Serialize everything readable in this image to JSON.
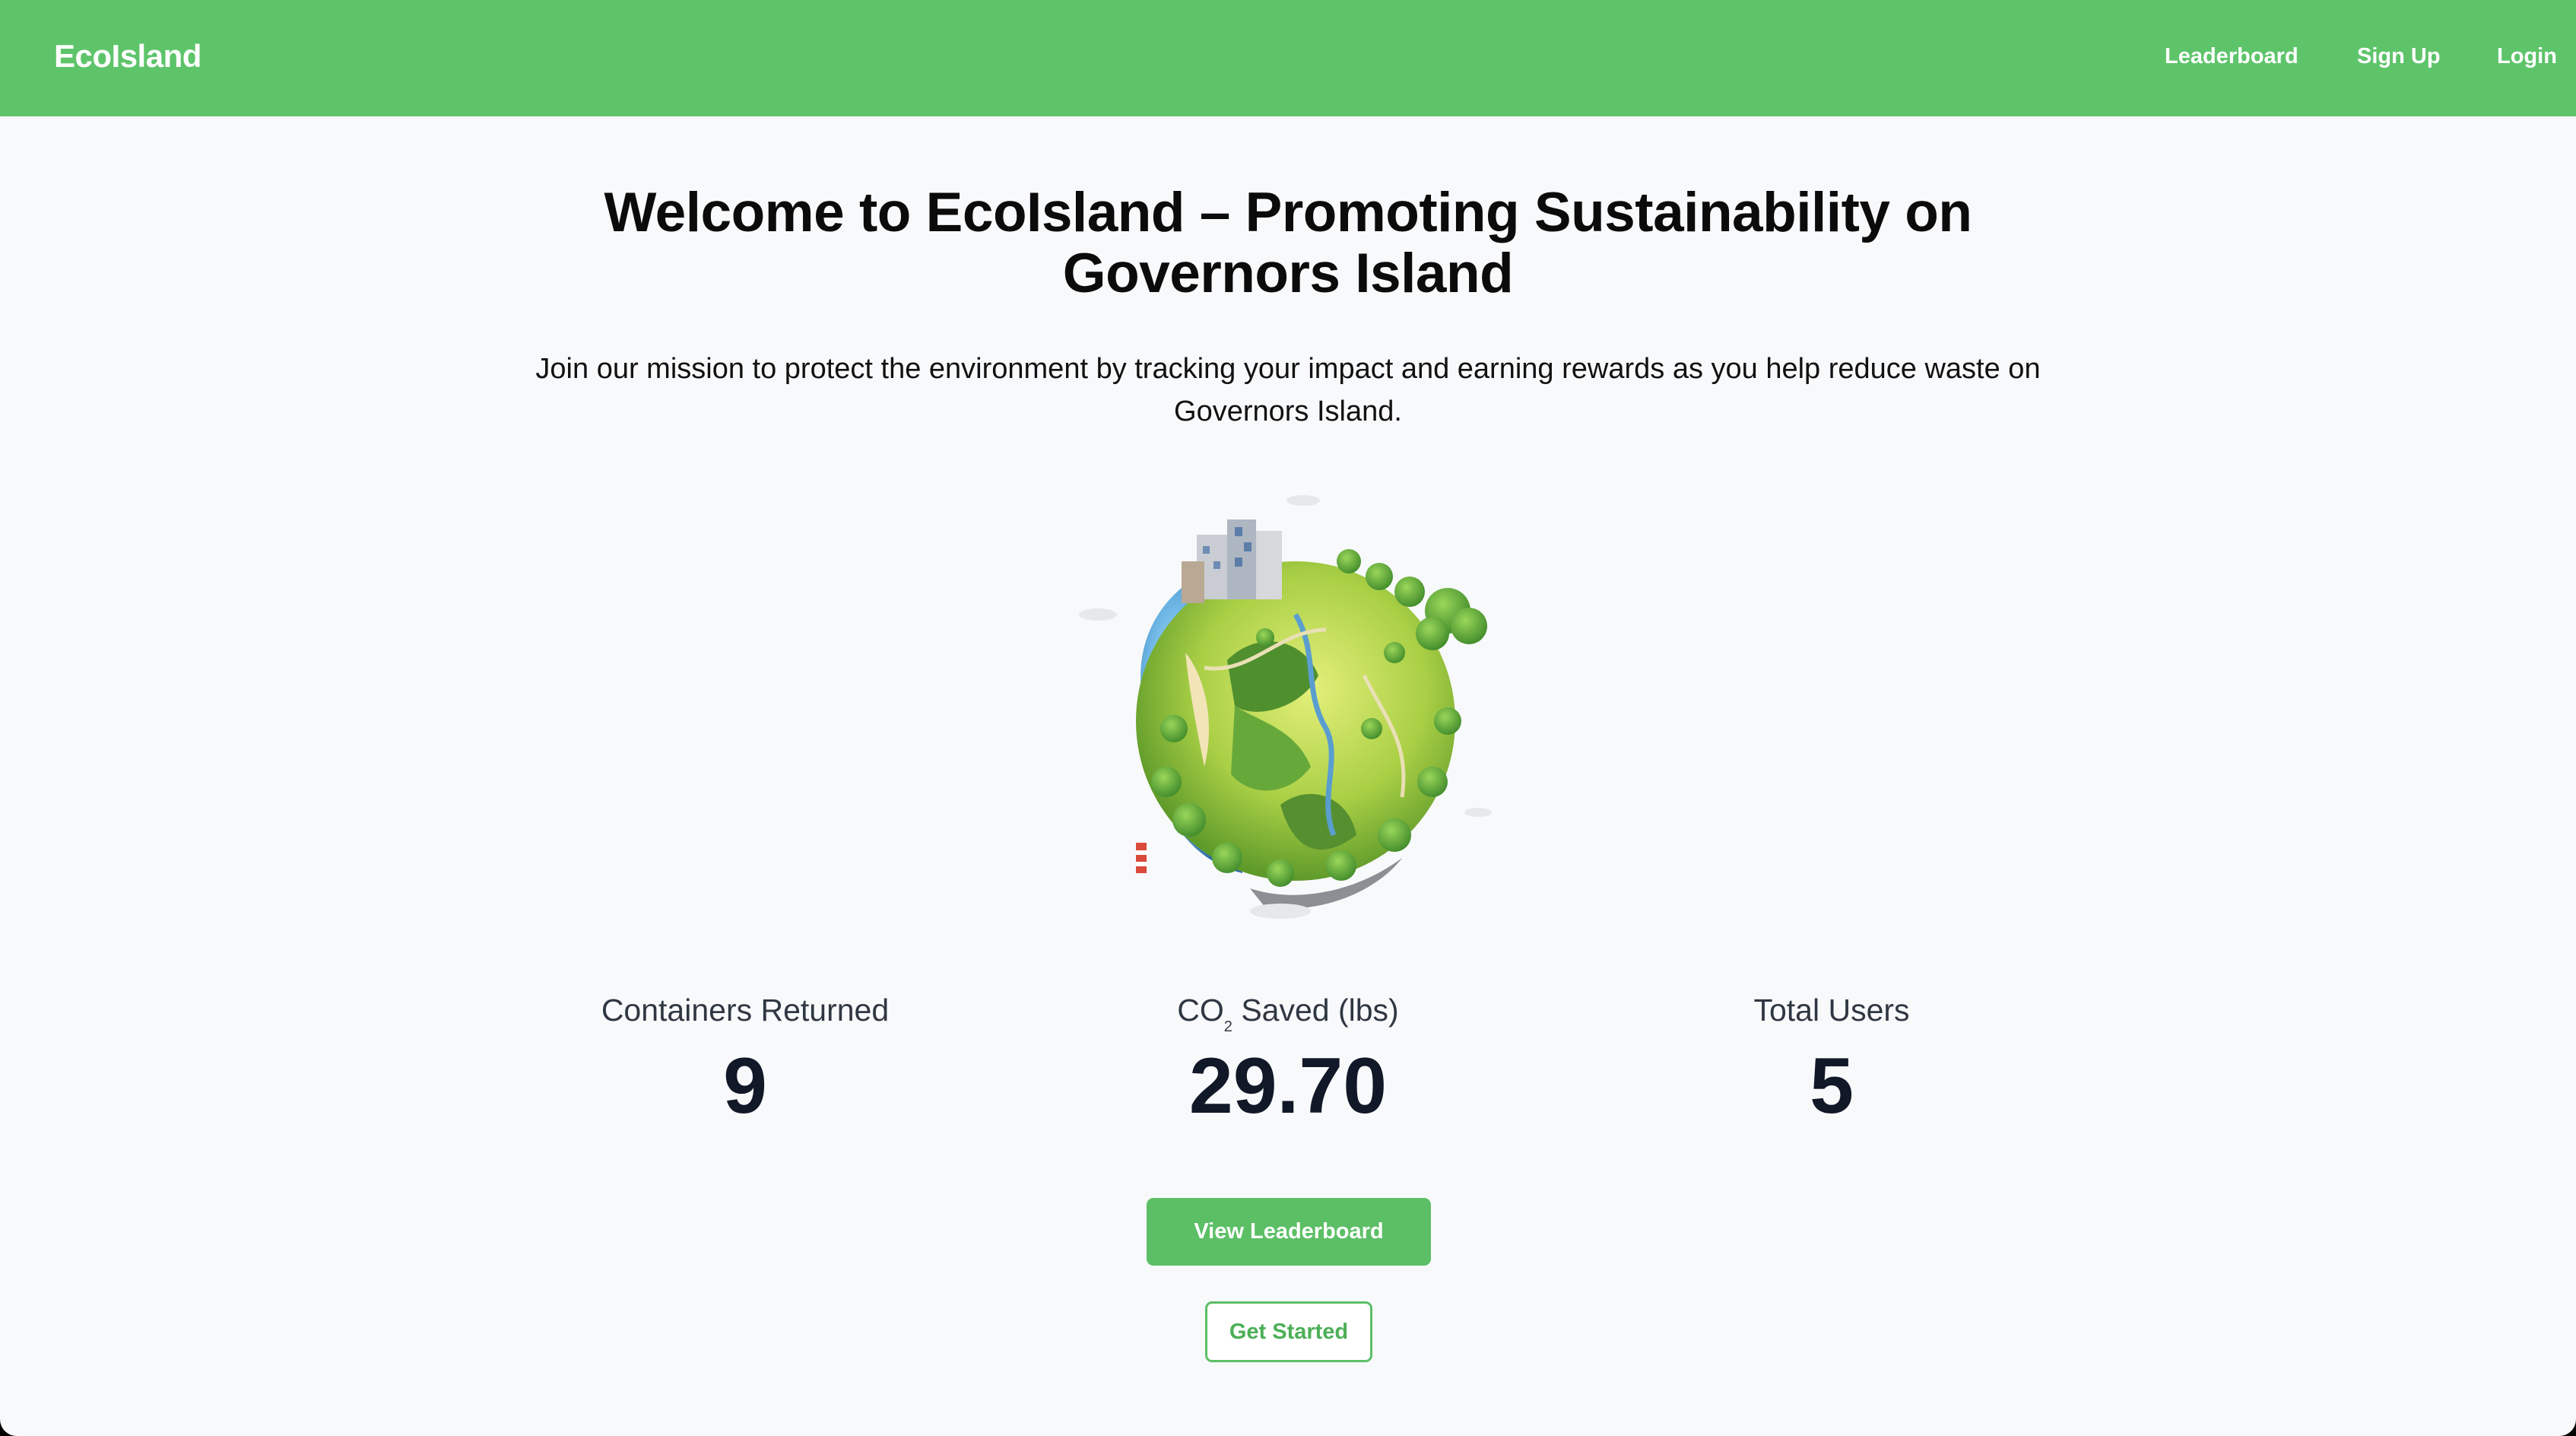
{
  "navbar": {
    "brand": "EcoIsland",
    "links": [
      {
        "label": "Leaderboard"
      },
      {
        "label": "Sign Up"
      },
      {
        "label": "Login"
      }
    ]
  },
  "hero": {
    "title_line1": "Welcome to EcoIsland – Promoting Sustainability on",
    "title_line2": "Governors Island",
    "subtitle_line1": "Join our mission to protect the environment by tracking your impact and earning rewards as you help reduce waste on",
    "subtitle_line2": "Governors Island.",
    "image": "earth-globe-illustration"
  },
  "stats": {
    "containers": {
      "label": "Containers Returned",
      "value": "9"
    },
    "co2": {
      "label_prefix": "CO",
      "label_sub": "2",
      "label_suffix": " Saved (lbs)",
      "value": "29.70"
    },
    "users": {
      "label": "Total Users",
      "value": "5"
    }
  },
  "actions": {
    "primary_label": "View Leaderboard",
    "secondary_label": "Get Started"
  },
  "colors": {
    "navbar": "#5ec46a",
    "primary": "#5cbf66",
    "background": "#f8f9fb",
    "text_dark": "#111827"
  }
}
